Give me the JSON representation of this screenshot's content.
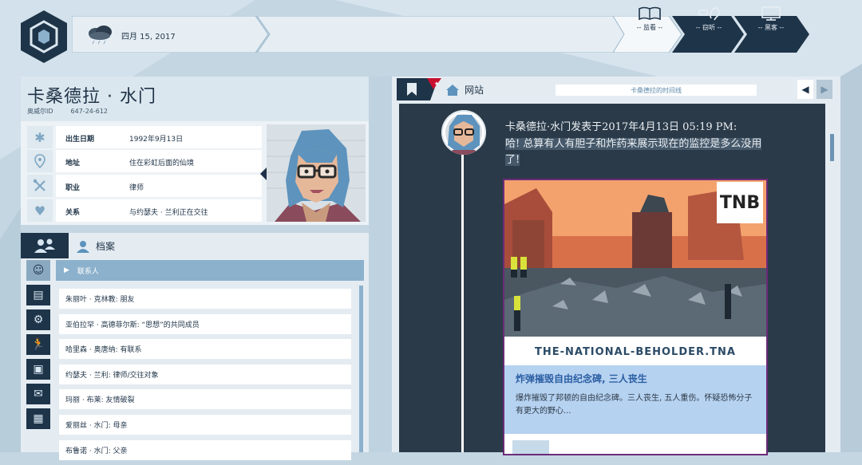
{
  "header": {
    "date": "四月 15, 2017",
    "tools": [
      {
        "label": "-- 监看 --"
      },
      {
        "label": "-- 窃听 --"
      },
      {
        "label": "-- 黑客 --"
      }
    ]
  },
  "profile": {
    "name": "卡桑德拉 · 水门",
    "id_label": "奥威尔ID",
    "id_value": "647-24-612",
    "fields": [
      {
        "icon": "asterisk-icon",
        "key": "出生日期",
        "value": "1992年9月13日"
      },
      {
        "icon": "location-pin-icon",
        "key": "地址",
        "value": "住在彩虹后面的仙境"
      },
      {
        "icon": "tools-icon",
        "key": "职业",
        "value": "律师"
      },
      {
        "icon": "hearts-icon",
        "key": "关系",
        "value": "与约瑟夫 · 兰利正在交往"
      }
    ]
  },
  "files": {
    "title": "档案",
    "section": "联系人",
    "contacts": [
      "朱丽叶 · 克林教: 朋友",
      "亚伯拉罕 · 高德菲尔斯: “思想”的共同成员",
      "哈里森 · 奥唐纳: 有联系",
      "约瑟夫 · 兰利: 律师/交往对象",
      "玛丽 · 布莱: 友情破裂",
      "爱丽丝 · 水门: 母亲",
      "布鲁诺 · 水门: 父亲"
    ]
  },
  "website": {
    "tab_label": "网站",
    "timeline_label": "卡桑德拉的时间线",
    "post": {
      "meta": "卡桑德拉·水门发表于2017年4月13日 05:19 PM:",
      "text": "哈! 总算有人有胆子和炸药来展示现在的监控是多么没用了!",
      "article": {
        "logo": "TNB",
        "site": "THE-NATIONAL-BEHOLDER.TNA",
        "headline": "炸弹摧毁自由纪念碑, 三人丧生",
        "summary": "爆炸摧毁了邦顿的自由纪念碑。三人丧生, 五人重伤。怀疑恐怖分子有更大的野心..."
      }
    }
  },
  "colors": {
    "navy": "#1e3449",
    "accent": "#8cb1cc",
    "feed_bg": "#2b3a48",
    "headline": "#2b5fa3",
    "article_border": "#6b2b79"
  }
}
